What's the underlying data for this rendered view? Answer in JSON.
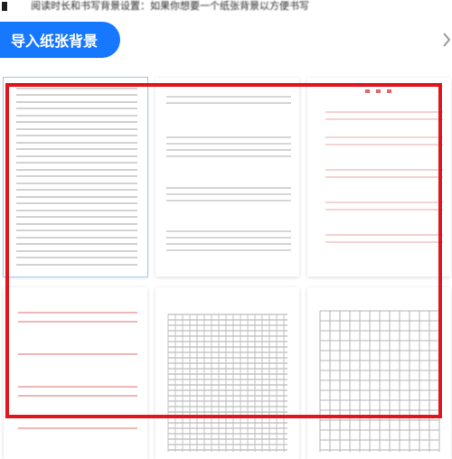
{
  "top_bar": {
    "caption": "阅读时长和书写背景设置：如果你想要一个纸张背景以方便书写"
  },
  "import_button": {
    "label": "导入纸张背景"
  },
  "icons": {
    "next": "chevron-right-icon"
  },
  "colors": {
    "accent": "#1677ff",
    "highlight": "#e2151b",
    "line_gray": "#b7b7b7",
    "line_red": "#e06868",
    "selected_border": "#a9c6ee"
  },
  "templates": [
    {
      "id": "dense-lines",
      "style": "gray horizontal lines",
      "selected": true
    },
    {
      "id": "sparse-line-groups",
      "style": "gray line groups",
      "selected": false
    },
    {
      "id": "red-header-lines",
      "style": "red header with pink lines",
      "selected": false
    },
    {
      "id": "red-lines",
      "style": "red horizontal lines",
      "selected": false
    },
    {
      "id": "dense-grid",
      "style": "dense gray grid",
      "selected": false
    },
    {
      "id": "square-grid",
      "style": "square grid",
      "selected": false
    }
  ]
}
